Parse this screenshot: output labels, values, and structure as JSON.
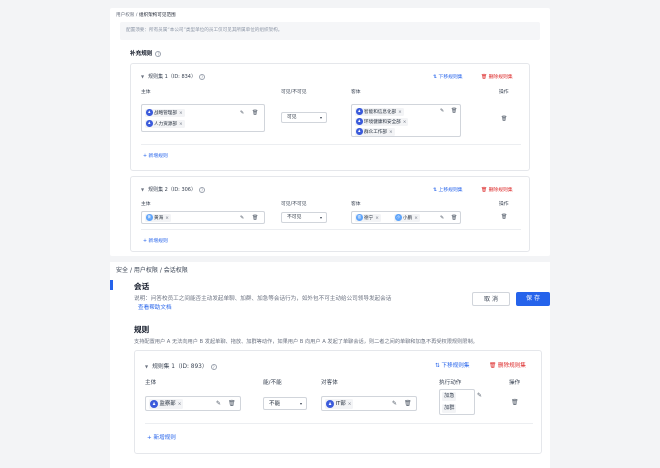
{
  "top": {
    "breadcrumb": {
      "parent": "用户权限",
      "sep": "/",
      "current": "组织架构可见范围"
    },
    "hint": "配置须要：所有员属“本公司”类型单位的员工仅可见其所属单位的组织架构。",
    "section_title": "补充规则",
    "rulesets": [
      {
        "title": "规则集 1（ID: 834）",
        "move_label": "下移规则集",
        "delete_label": "删除规则集",
        "col_subject": "主体",
        "col_visibility": "可见/不可见",
        "col_object": "客体",
        "col_ops": "操作",
        "subjects": [
          "战略管理部",
          "人力资源部"
        ],
        "visibility": "可见",
        "objects": [
          "智能和信息化部",
          "环境健康和安全部",
          "群众工作部"
        ],
        "add_rule": "新增规则"
      },
      {
        "title": "规则集 2（ID: 306）",
        "move_label": "上移规则集",
        "delete_label": "删除规则集",
        "col_subject": "主体",
        "col_visibility": "可见/不可见",
        "col_object": "客体",
        "col_ops": "操作",
        "subjects": [
          "黄海"
        ],
        "visibility": "不可见",
        "objects": [
          "德宁",
          "小鹏"
        ],
        "add_rule": "新增规则"
      }
    ]
  },
  "bottom": {
    "breadcrumb": {
      "a": "安全",
      "sep": "/",
      "b": "用户权限",
      "c": "会话权限"
    },
    "session_title": "会话",
    "description": "说明：问答校员工之间能否主动发起单聊、加群、加急等会话行为，如外包不可主动给公司领导发起会话",
    "doc_link": "查看帮助文档",
    "cancel": "取 消",
    "save": "保 存",
    "rules_title": "规则",
    "rules_desc": "支持配置用户 A 无法向用户 B 发起单聊、拖放、加群等动作，如果用户 B 向用户 A 发起了单聊会话，则二者之间的单聊和加急不再受权限规则限制。",
    "ruleset": {
      "title": "规则集 1（ID: 893）",
      "move_label": "下移规则集",
      "delete_label": "删除规则集",
      "col_subject": "主体",
      "col_allow": "能/不能",
      "col_object": "对客体",
      "col_action": "执行动作",
      "col_ops": "操作",
      "subject": "监察部",
      "allow": "不能",
      "object": "IT部",
      "actions": [
        "加急",
        "加群"
      ],
      "add_rule": "新增规则"
    }
  },
  "colors": {
    "accent": "#2563eb",
    "danger": "#dc2626",
    "avatar": "#3b5bdb"
  },
  "icons": [
    "edit-icon",
    "trash-icon",
    "swap-icon",
    "help-icon",
    "chevron-down-icon",
    "plus-icon"
  ]
}
